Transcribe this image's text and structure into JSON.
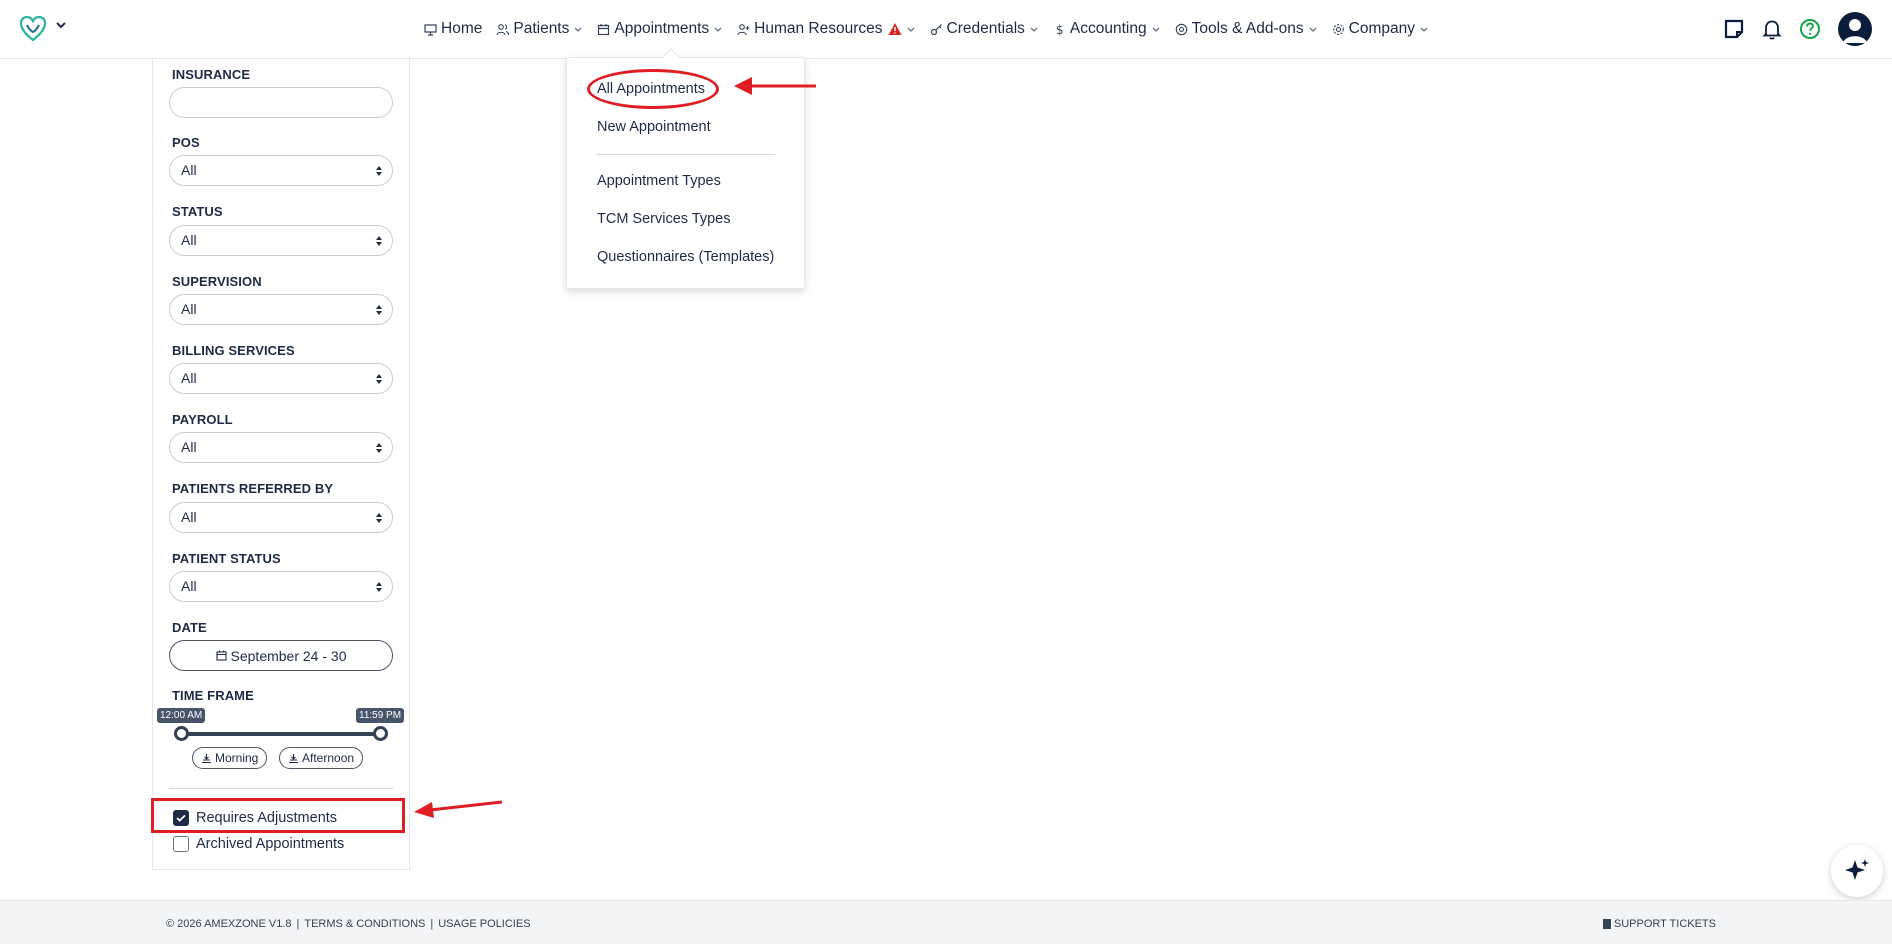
{
  "nav": {
    "items": [
      {
        "label": "Home",
        "icon": "monitor-icon"
      },
      {
        "label": "Patients",
        "icon": "users-icon"
      },
      {
        "label": "Appointments",
        "icon": "calendar-icon"
      },
      {
        "label": "Human Resources",
        "icon": "user-plus-icon"
      },
      {
        "label": "Credentials",
        "icon": "key-icon"
      },
      {
        "label": "Accounting",
        "icon": "dollar-icon"
      },
      {
        "label": "Tools & Add-ons",
        "icon": "at-icon"
      },
      {
        "label": "Company",
        "icon": "gear-icon"
      }
    ],
    "right_icons": [
      "notes-icon",
      "bell-icon",
      "help-icon",
      "avatar"
    ]
  },
  "appointments_menu": {
    "items": [
      "All Appointments",
      "New Appointment",
      "Appointment Types",
      "TCM Services Types",
      "Questionnaires (Templates)"
    ]
  },
  "filters": {
    "insurance_label": "INSURANCE",
    "insurance_value": "",
    "pos_label": "POS",
    "pos_value": "All",
    "status_label": "STATUS",
    "status_value": "All",
    "supervision_label": "SUPERVISION",
    "supervision_value": "All",
    "billing_label": "BILLING SERVICES",
    "billing_value": "All",
    "payroll_label": "PAYROLL",
    "payroll_value": "All",
    "referred_label": "PATIENTS REFERRED BY",
    "referred_value": "All",
    "patient_status_label": "PATIENT STATUS",
    "patient_status_value": "All",
    "date_label": "DATE",
    "date_value": "September 24 - 30",
    "timeframe_label": "TIME FRAME",
    "time_start": "12:00 AM",
    "time_end": "11:59 PM",
    "morning_label": "Morning",
    "afternoon_label": "Afternoon",
    "requires_adjustments_label": "Requires Adjustments",
    "requires_adjustments_checked": true,
    "archived_label": "Archived Appointments",
    "archived_checked": false
  },
  "footer": {
    "copyright": "© 2026 AMEXZONE V1.8",
    "terms": "TERMS & CONDITIONS",
    "usage": "USAGE POLICIES",
    "support": "SUPPORT TICKETS"
  },
  "colors": {
    "brand": "#1f2a44",
    "annotation_red": "#e11d24",
    "help_green": "#16a34a",
    "logo_teal": "#2bb5a0"
  }
}
